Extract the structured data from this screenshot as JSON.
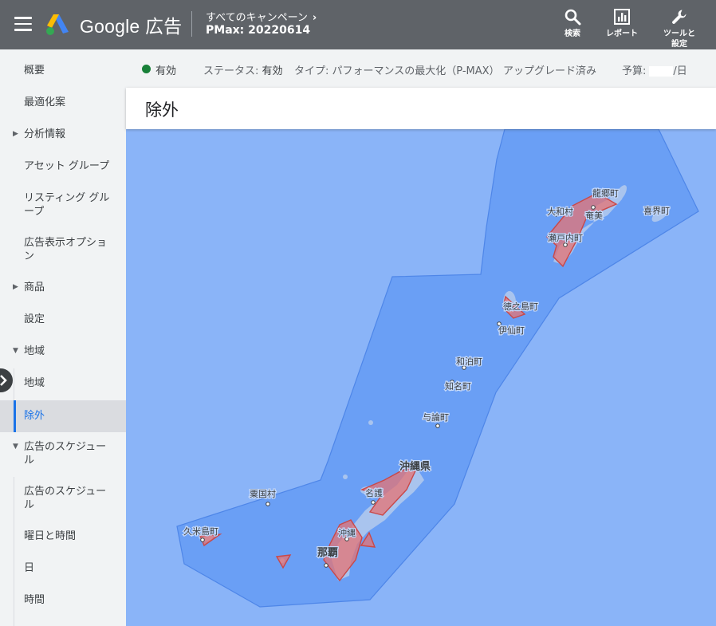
{
  "header": {
    "logo_text": "Google 広告",
    "breadcrumb_parent": "すべてのキャンペーン",
    "campaign_name": "PMax: 20220614",
    "tools": [
      {
        "label": "検索",
        "icon": "search-icon"
      },
      {
        "label": "レポート",
        "icon": "bar-chart-icon"
      },
      {
        "label": "ツールと設定",
        "icon": "wrench-icon"
      }
    ]
  },
  "sidebar": {
    "items": [
      {
        "label": "概要"
      },
      {
        "label": "最適化案"
      },
      {
        "label": "分析情報"
      },
      {
        "label": "アセット グループ"
      },
      {
        "label": "リスティング グループ"
      },
      {
        "label": "広告表示オプション"
      },
      {
        "label": "商品"
      },
      {
        "label": "設定"
      },
      {
        "label": "地域"
      },
      {
        "label": "地域"
      },
      {
        "label": "除外"
      },
      {
        "label": "広告のスケジュール"
      },
      {
        "label": "広告のスケジュール"
      },
      {
        "label": "曜日と時間"
      },
      {
        "label": "日"
      },
      {
        "label": "時間"
      }
    ]
  },
  "status_bar": {
    "status": "有効",
    "status_label": "ステータス:",
    "status_value": "有効",
    "type_label": "タイプ:",
    "type_value": "パフォーマンスの最大化（P-MAX）",
    "upgrade": "アップグレード済み",
    "budget_label": "予算:",
    "budget_suffix": "/日"
  },
  "page": {
    "title": "除外"
  },
  "map": {
    "labels": {
      "tatsugo": "龍郷町",
      "yamato": "大和村",
      "amami": "奄美",
      "kikai": "喜界町",
      "setouchi": "瀬戸内町",
      "tokunoshima": "徳之島町",
      "isen": "伊仙町",
      "wadomari": "和泊町",
      "china": "知名町",
      "yoron": "与論町",
      "okinawa_pref": "沖縄県",
      "nago": "名護",
      "aguni": "粟国村",
      "kumejima": "久米島町",
      "okinawa_city": "沖縄",
      "naha": "那覇"
    }
  },
  "colors": {
    "header_bg": "#5f6368",
    "sidebar_bg": "#f1f3f4",
    "active_accent": "#1a73e8",
    "status_green": "#188038",
    "sea": "#8ab4f8",
    "targeted_area": "#5e97f6",
    "excluded_area": "#e57373"
  }
}
